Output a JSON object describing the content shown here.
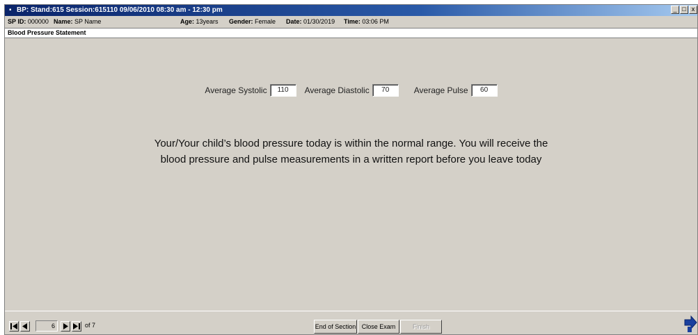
{
  "window": {
    "title": "BP: Stand:615 Session:615110 09/06/2010 08:30 am - 12:30 pm"
  },
  "info": {
    "sp_id_label": "SP ID:",
    "sp_id_value": "000000",
    "name_label": "Name:",
    "name_value": "SP Name",
    "age_label": "Age:",
    "age_value": "13years",
    "gender_label": "Gender:",
    "gender_value": "Female",
    "date_label": "Date:",
    "date_value": "01/30/2019",
    "time_label": "Time:",
    "time_value": "03:06 PM"
  },
  "section": {
    "title": "Blood Pressure Statement"
  },
  "measurements": {
    "systolic_label": "Average Systolic",
    "systolic_value": "110",
    "diastolic_label": "Average Diastolic",
    "diastolic_value": "70",
    "pulse_label": "Average Pulse",
    "pulse_value": "60"
  },
  "statement": {
    "line1": "Your/Your child’s blood pressure today is within the normal range. You will receive the",
    "line2": "blood pressure and pulse measurements in a written report before you leave today"
  },
  "footer": {
    "page_value": "6",
    "of_text": "of 7",
    "end_section_label": "End of Section",
    "close_exam_label": "Close Exam",
    "finish_label": "Finish"
  },
  "icons": {
    "first": "first-page-icon",
    "prev": "previous-page-icon",
    "next": "next-page-icon",
    "last": "last-page-icon",
    "exit": "exit-arrow-icon"
  },
  "colors": {
    "title_bar": "#0a246a",
    "window_bg": "#d4d0c8",
    "exit_icon": "#1a3f9e"
  }
}
